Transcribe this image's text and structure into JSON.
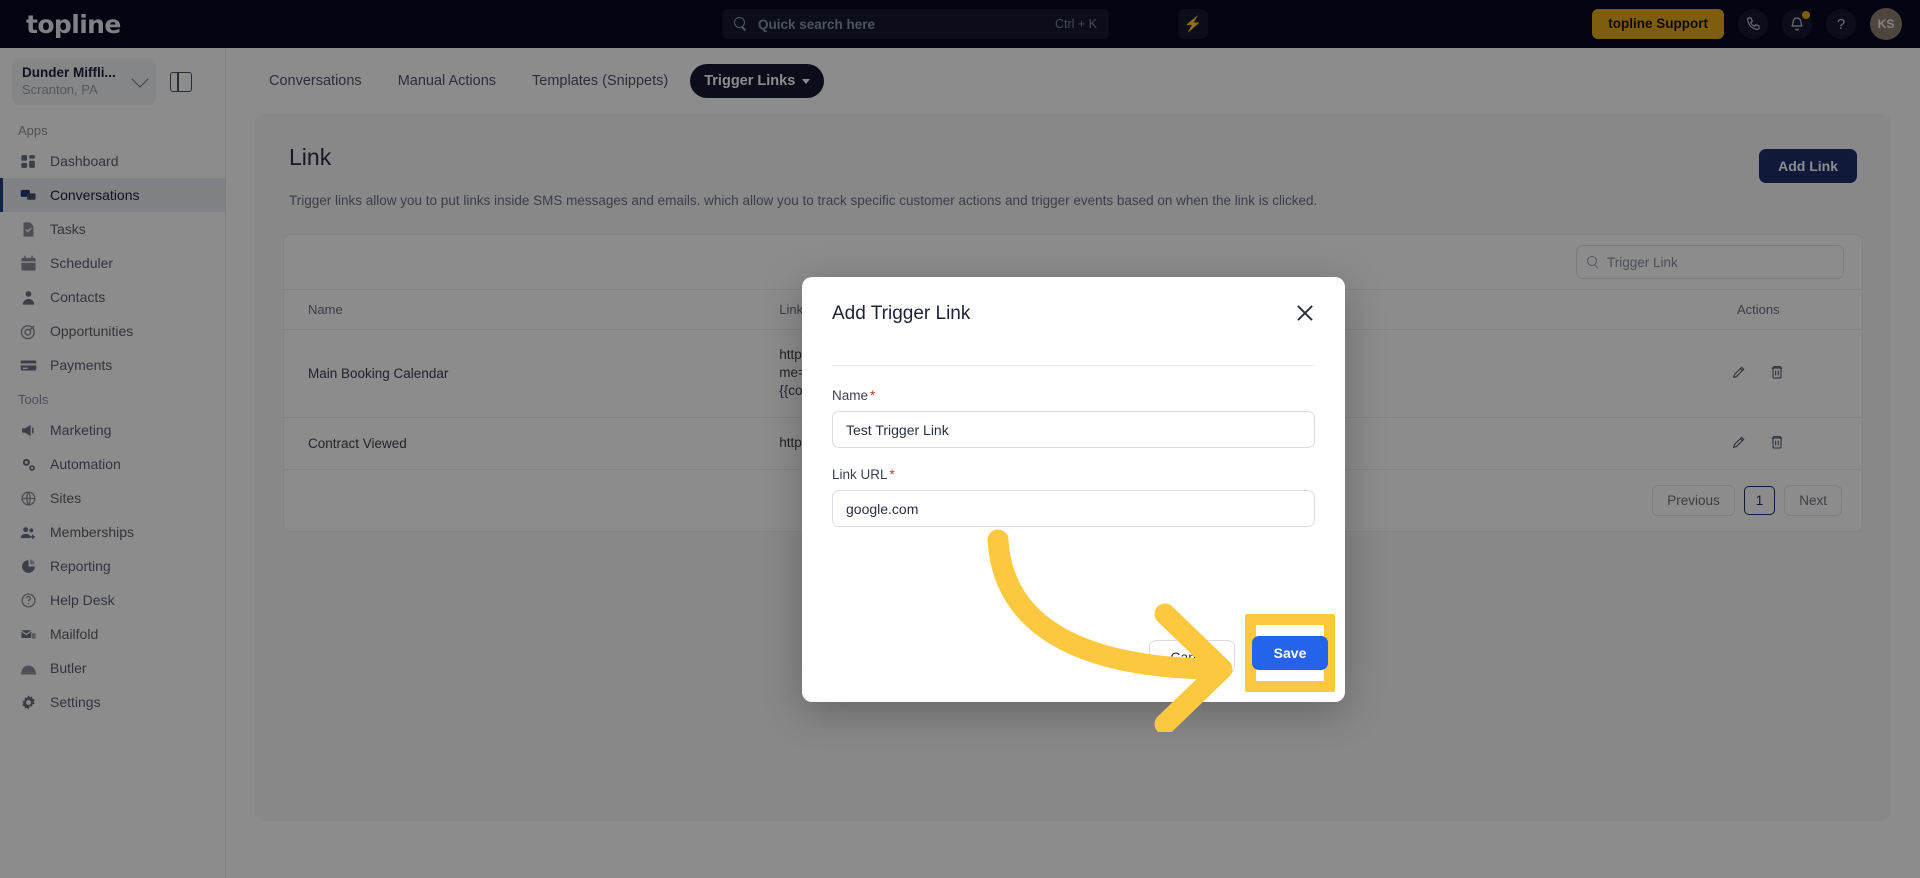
{
  "topbar": {
    "logo": "topline",
    "search_placeholder": "Quick search here",
    "search_shortcut": "Ctrl + K",
    "bolt_glyph": "⚡",
    "support_label": "topline Support",
    "help_glyph": "?",
    "avatar_initials": "KS"
  },
  "sidebar": {
    "location_name": "Dunder Miffli...",
    "location_sub": "Scranton, PA",
    "group_apps": "Apps",
    "group_tools": "Tools",
    "apps": [
      {
        "label": "Dashboard",
        "icon": "dashboard-icon",
        "active": false
      },
      {
        "label": "Conversations",
        "icon": "chat-bubbles-icon",
        "active": true
      },
      {
        "label": "Tasks",
        "icon": "task-check-icon",
        "active": false
      },
      {
        "label": "Scheduler",
        "icon": "calendar-icon",
        "active": false
      },
      {
        "label": "Contacts",
        "icon": "person-icon",
        "active": false
      },
      {
        "label": "Opportunities",
        "icon": "target-icon",
        "active": false
      },
      {
        "label": "Payments",
        "icon": "credit-card-icon",
        "active": false
      }
    ],
    "tools": [
      {
        "label": "Marketing",
        "icon": "megaphone-icon"
      },
      {
        "label": "Automation",
        "icon": "gears-icon"
      },
      {
        "label": "Sites",
        "icon": "globe-icon"
      },
      {
        "label": "Memberships",
        "icon": "users-plus-icon"
      },
      {
        "label": "Reporting",
        "icon": "pie-chart-icon"
      },
      {
        "label": "Help Desk",
        "icon": "question-circle-icon"
      },
      {
        "label": "Mailfold",
        "icon": "mail-stack-icon"
      },
      {
        "label": "Butler",
        "icon": "bell-dome-icon"
      },
      {
        "label": "Settings",
        "icon": "gear-icon"
      }
    ]
  },
  "tabs": [
    {
      "label": "Conversations",
      "active": false
    },
    {
      "label": "Manual Actions",
      "active": false
    },
    {
      "label": "Templates (Snippets)",
      "active": false
    },
    {
      "label": "Trigger Links",
      "active": true
    }
  ],
  "page": {
    "title": "Link",
    "description": "Trigger links allow you to put links inside SMS messages and emails. which allow you to track specific customer actions and trigger events based on when the link is clicked.",
    "add_link_label": "Add Link"
  },
  "table": {
    "search_placeholder": "Trigger Link",
    "columns": [
      "Name",
      "Link URL",
      "Actions"
    ],
    "rows": [
      {
        "name": "Main Booking Calendar",
        "url": "https://ms\nme={{con\n{{contact.",
        "edit_icon": "pencil-icon",
        "delete_icon": "trash-icon"
      },
      {
        "name": "Contract Viewed",
        "url": "https://sit",
        "edit_icon": "pencil-icon",
        "delete_icon": "trash-icon"
      }
    ],
    "pagination": {
      "previous": "Previous",
      "page": "1",
      "next": "Next"
    }
  },
  "modal": {
    "title": "Add Trigger Link",
    "close_icon": "close-icon",
    "name_label": "Name",
    "name_required": "*",
    "name_value": "Test Trigger Link",
    "url_label": "Link URL",
    "url_required": "*",
    "url_value": "google.com",
    "cancel_label": "Cancel",
    "save_label": "Save"
  },
  "annotation": {
    "arrow_color": "#fbc840",
    "highlight_color": "#fbc840"
  },
  "colors": {
    "topbar_bg": "#04091f",
    "accent_yellow": "#e8a91b",
    "primary_blue": "#2563eb",
    "navy": "#1e2f6b"
  }
}
